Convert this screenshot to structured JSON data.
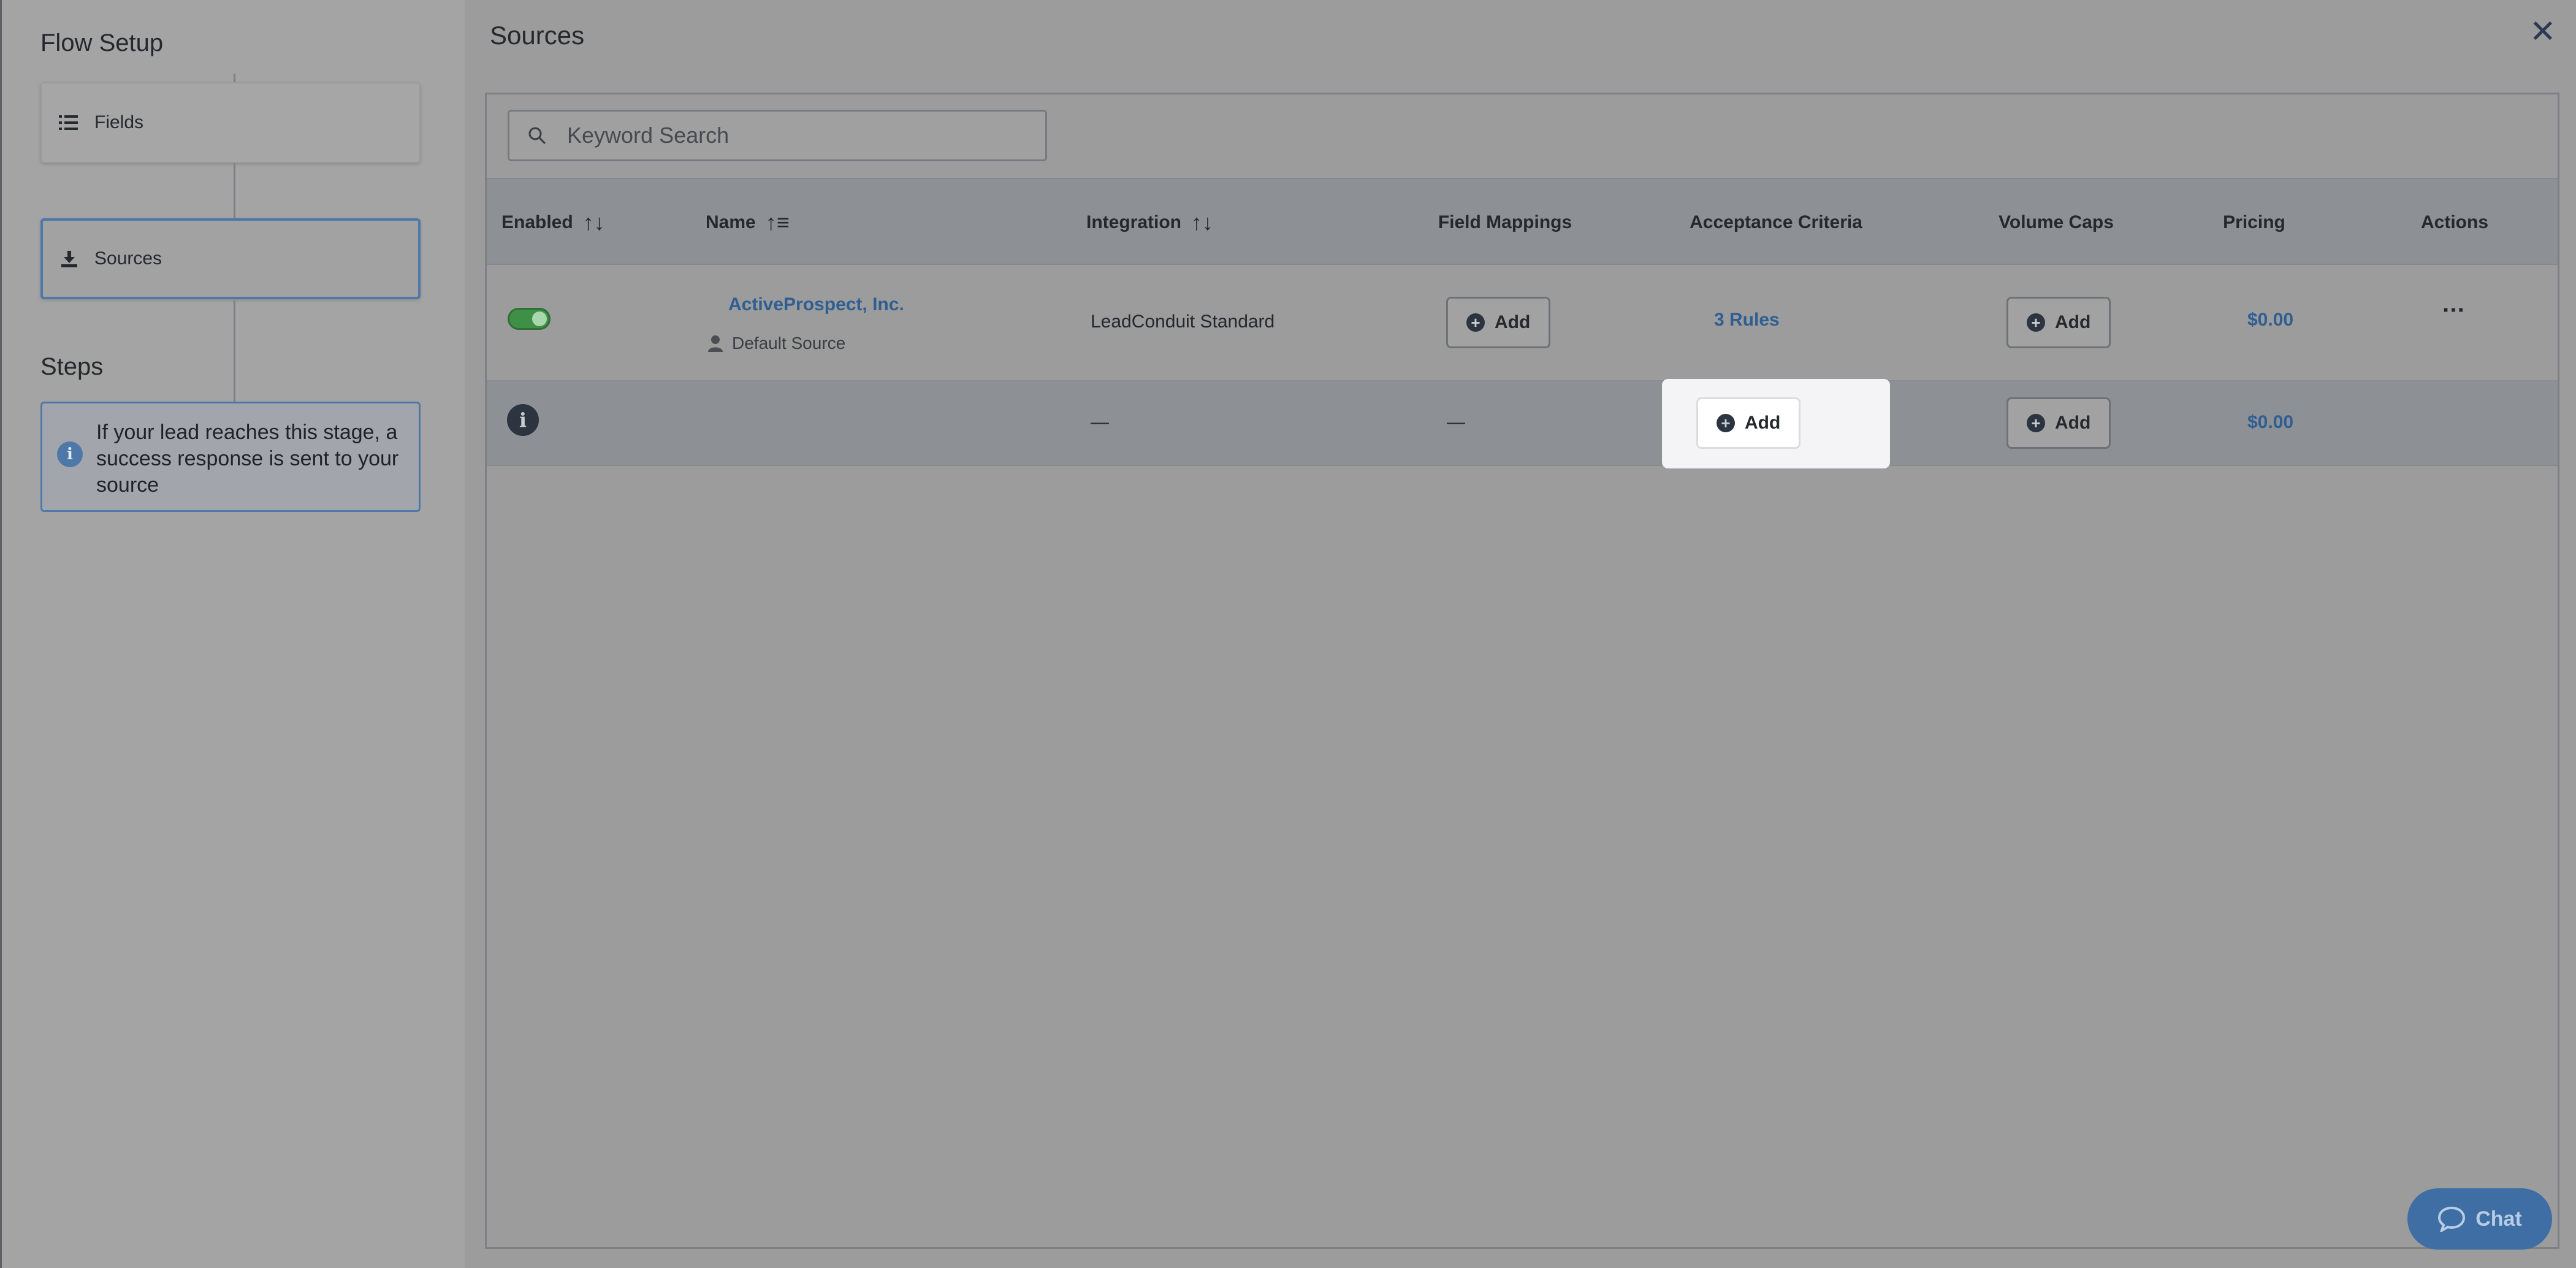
{
  "sidebar": {
    "title": "Flow Setup",
    "fields_label": "Fields",
    "sources_label": "Sources",
    "steps_title": "Steps",
    "info_text": "If your lead reaches this stage, a success response is sent to your source"
  },
  "main": {
    "title": "Sources",
    "search_placeholder": "Keyword Search"
  },
  "table": {
    "headers": {
      "enabled": "Enabled",
      "name": "Name",
      "integration": "Integration",
      "field_mappings": "Field Mappings",
      "acceptance_criteria": "Acceptance Criteria",
      "volume_caps": "Volume Caps",
      "pricing": "Pricing",
      "actions": "Actions"
    },
    "row1": {
      "name": "ActiveProspect, Inc.",
      "subtitle": "Default Source",
      "integration": "LeadConduit Standard",
      "field_mappings": "Add",
      "acceptance": "3 Rules",
      "volume": "Add",
      "pricing": "$0.00",
      "actions": "···"
    },
    "row2": {
      "integration": "—",
      "field_mappings": "—",
      "acceptance": "Add",
      "volume": "Add",
      "pricing": "$0.00"
    }
  },
  "chat_label": "Chat",
  "colors": {
    "accent": "#4e78a8",
    "toggle_on": "#3f8f46",
    "link": "#2f5e92"
  }
}
